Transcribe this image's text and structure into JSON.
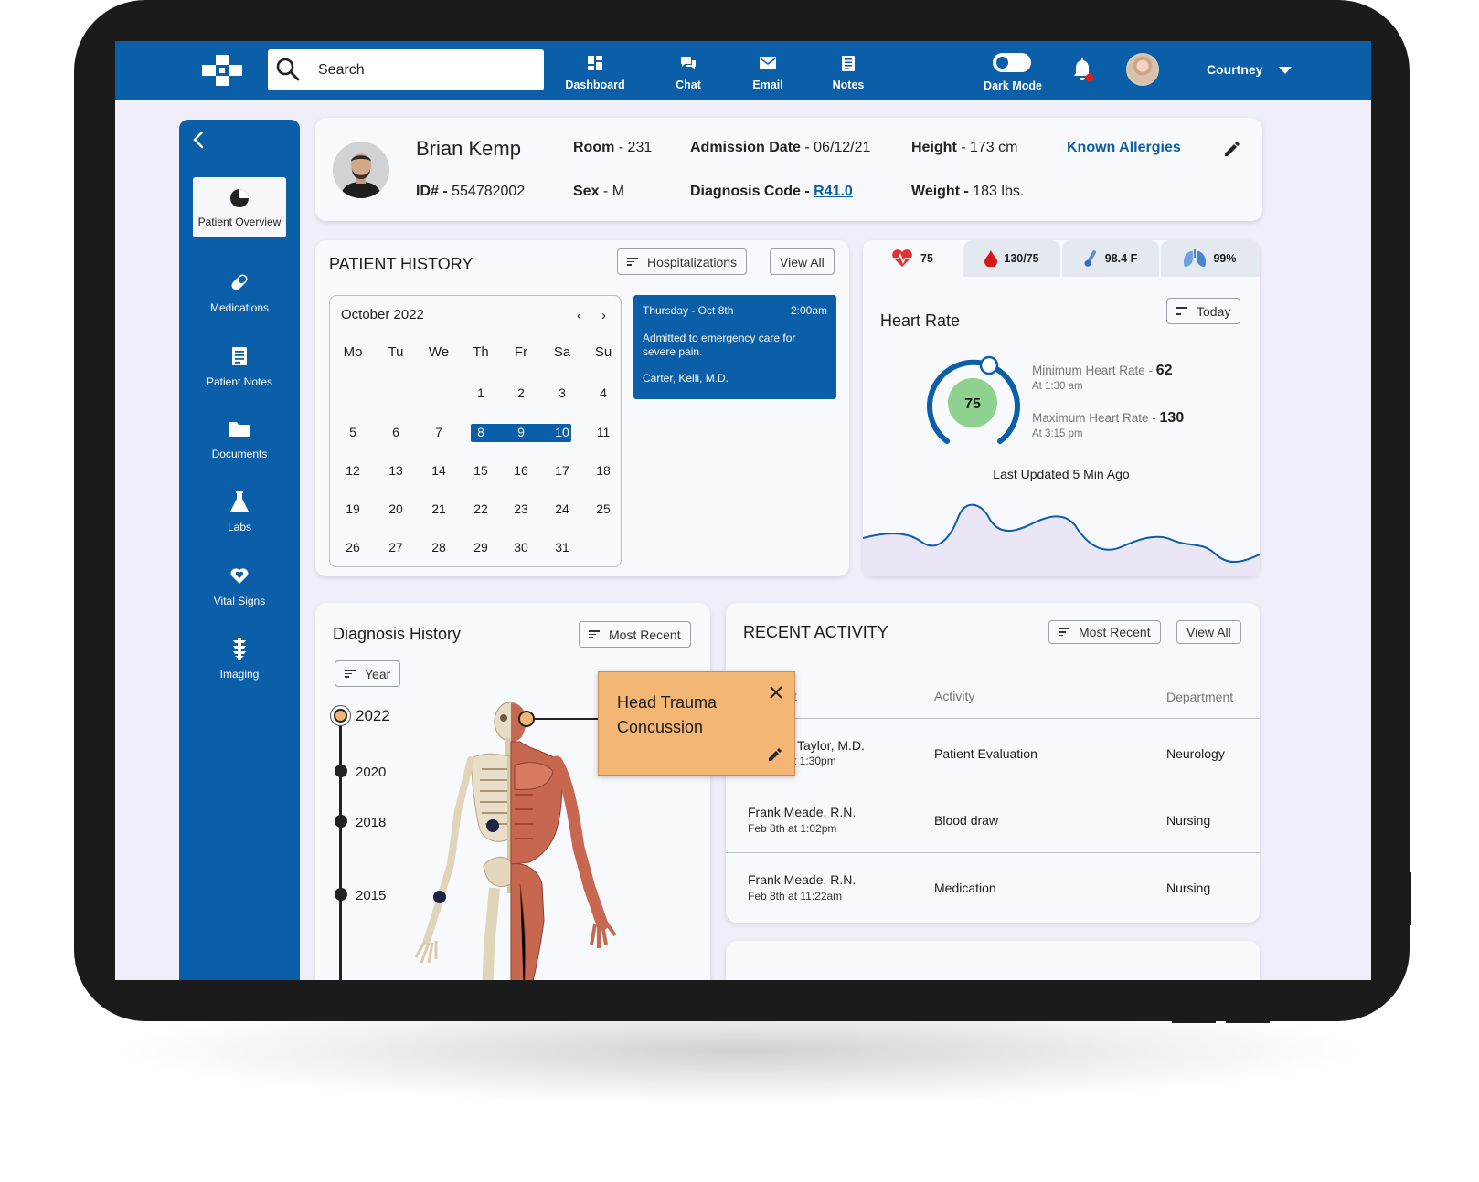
{
  "topbar": {
    "search_placeholder": "Search",
    "nav": [
      {
        "label": "Dashboard",
        "icon": "dashboard-icon"
      },
      {
        "label": "Chat",
        "icon": "chat-icon"
      },
      {
        "label": "Email",
        "icon": "email-icon"
      },
      {
        "label": "Notes",
        "icon": "notes-icon"
      }
    ],
    "dark_mode_label": "Dark Mode",
    "user_name": "Courtney"
  },
  "sidebar": {
    "items": [
      {
        "label": "Patient Overview",
        "icon": "pie-chart-icon",
        "active": true
      },
      {
        "label": "Medications",
        "icon": "pill-icon"
      },
      {
        "label": "Patient Notes",
        "icon": "notes-icon"
      },
      {
        "label": "Documents",
        "icon": "folder-icon"
      },
      {
        "label": "Labs",
        "icon": "flask-icon"
      },
      {
        "label": "Vital Signs",
        "icon": "heart-icon"
      },
      {
        "label": "Imaging",
        "icon": "spine-icon"
      }
    ]
  },
  "patient": {
    "name": "Brian Kemp",
    "id_label": "ID# - ",
    "id": "554782002",
    "room_label": "Room",
    "room": " - 231",
    "sex_label": "Sex",
    "sex": " - M",
    "admission_label": "Admission Date",
    "admission": " - 06/12/21",
    "diagnosis_label": "Diagnosis Code - ",
    "diagnosis_code": "R41.0",
    "height_label": "Height",
    "height": " - 173 cm",
    "weight_label": "Weight - ",
    "weight": "183 lbs.",
    "allergies_link": "Known Allergies"
  },
  "history": {
    "title": "PATIENT HISTORY",
    "filter": "Hospitalizations",
    "view_all": "View All",
    "month": "October 2022",
    "weekdays": [
      "Mo",
      "Tu",
      "We",
      "Th",
      "Fr",
      "Sa",
      "Su"
    ],
    "selected_days": [
      8,
      9,
      10
    ],
    "event": {
      "day": "Thursday - Oct 8th",
      "time": "2:00am",
      "text": "Admitted to emergency care for severe pain.",
      "doctor": "Carter, Kelli, M.D."
    }
  },
  "vitals": {
    "tabs": [
      {
        "value": "75",
        "icon": "heart-rate-icon"
      },
      {
        "value": "130/75",
        "icon": "blood-drop-icon"
      },
      {
        "value": "98.4 F",
        "icon": "thermometer-icon"
      },
      {
        "value": "99%",
        "icon": "lungs-icon"
      }
    ],
    "title": "Heart Rate",
    "filter": "Today",
    "current": "75",
    "min_label": "Minimum Heart Rate - ",
    "min": "62",
    "min_time": "At 1:30 am",
    "max_label": "Maximum Heart Rate - ",
    "max": "130",
    "max_time": "At 3:15 pm",
    "updated": "Last Updated 5 Min Ago",
    "colors": {
      "accent": "#0b5ea8",
      "ok": "#8fd18f"
    }
  },
  "diagnosis": {
    "title": "Diagnosis History",
    "filter": "Most Recent",
    "year_filter": "Year",
    "years": [
      "2022",
      "2020",
      "2018",
      "2015"
    ],
    "popup_line1": "Head Trauma",
    "popup_line2": "Concussion",
    "popup_color": "#f4b675"
  },
  "activity": {
    "title": "RECENT ACTIVITY",
    "filter": "Most Recent",
    "view_all": "View All",
    "headers": [
      "t",
      "Activity",
      "Department"
    ],
    "rows": [
      {
        "name": "Taylor, M.D.",
        "time": "t 1:30pm",
        "activity": "Patient Evaluation",
        "department": "Neurology"
      },
      {
        "name": "Frank Meade, R.N.",
        "time": "Feb 8th at 1:02pm",
        "activity": "Blood draw",
        "department": "Nursing"
      },
      {
        "name": "Frank Meade, R.N.",
        "time": "Feb 8th at 11:22am",
        "activity": "Medication",
        "department": "Nursing"
      }
    ]
  }
}
